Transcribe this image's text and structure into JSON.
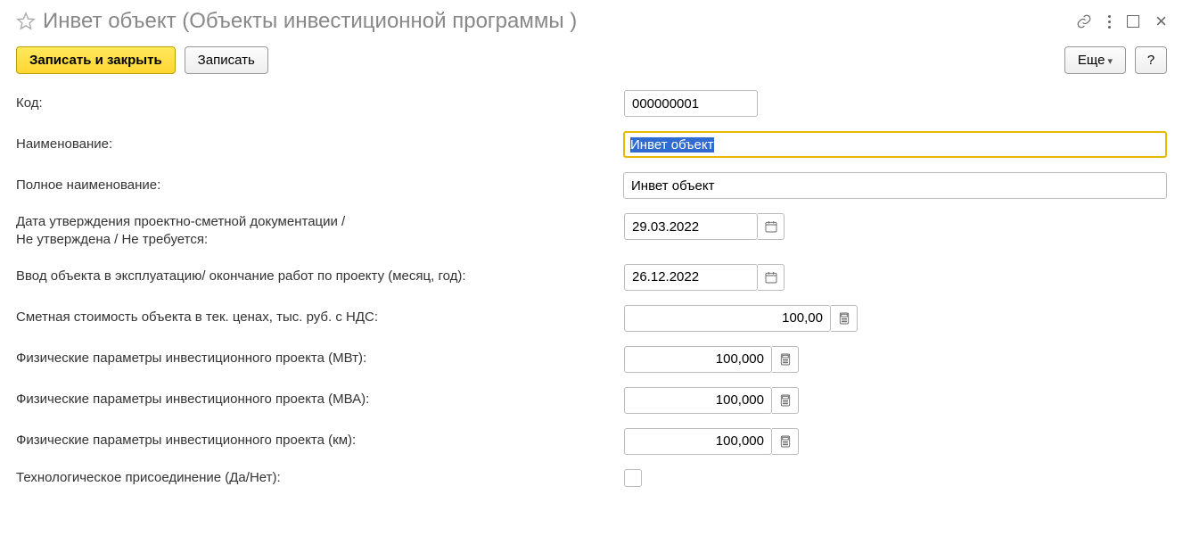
{
  "header": {
    "title": "Инвет объект (Объекты инвестиционной программы )"
  },
  "toolbar": {
    "save_close": "Записать и закрыть",
    "save": "Записать",
    "more": "Еще",
    "help": "?"
  },
  "labels": {
    "code": "Код:",
    "name": "Наименование:",
    "full_name": "Полное наименование:",
    "approval_date_1": "Дата утверждения проектно-сметной документации /",
    "approval_date_2": "Не утверждена / Не требуется:",
    "commissioning": "Ввод объекта в эксплуатацию/ окончание работ по проекту (месяц, год):",
    "est_cost": "Сметная стоимость объекта в тек. ценах, тыс. руб. с НДС:",
    "phys_mw": "Физические параметры инвестиционного проекта (МВт):",
    "phys_mva": "Физические параметры инвестиционного проекта (МВА):",
    "phys_km": "Физические параметры инвестиционного проекта (км):",
    "tech_conn": "Технологическое присоединение (Да/Нет):"
  },
  "values": {
    "code": "000000001",
    "name": "Инвет объект",
    "full_name": "Инвет объект",
    "approval_date": "29.03.2022",
    "commissioning": "26.12.2022",
    "est_cost": "100,00",
    "phys_mw": "100,000",
    "phys_mva": "100,000",
    "phys_km": "100,000"
  }
}
